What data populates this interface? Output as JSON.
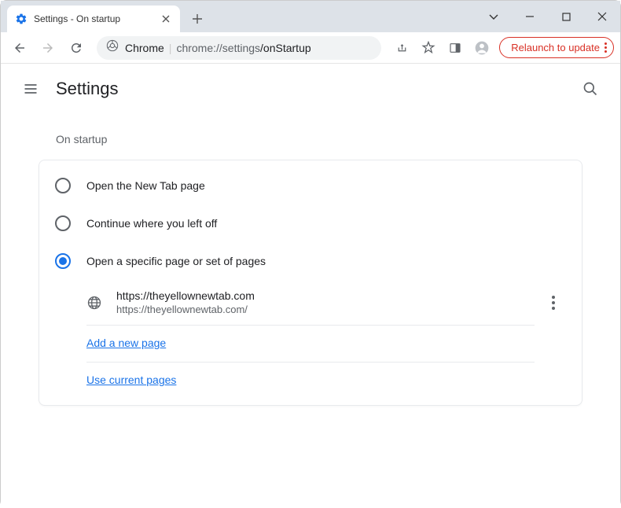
{
  "window": {
    "tab_title": "Settings - On startup"
  },
  "toolbar": {
    "omnibox_host": "Chrome",
    "omnibox_prefix": "chrome://settings",
    "omnibox_suffix": "/onStartup",
    "relaunch_label": "Relaunch to update"
  },
  "header": {
    "title": "Settings"
  },
  "section": {
    "title": "On startup",
    "options": [
      {
        "label": "Open the New Tab page",
        "selected": false
      },
      {
        "label": "Continue where you left off",
        "selected": false
      },
      {
        "label": "Open a specific page or set of pages",
        "selected": true
      }
    ],
    "page": {
      "title": "https://theyellownewtab.com",
      "url": "https://theyellownewtab.com/"
    },
    "add_page_label": "Add a new page",
    "use_current_label": "Use current pages"
  }
}
